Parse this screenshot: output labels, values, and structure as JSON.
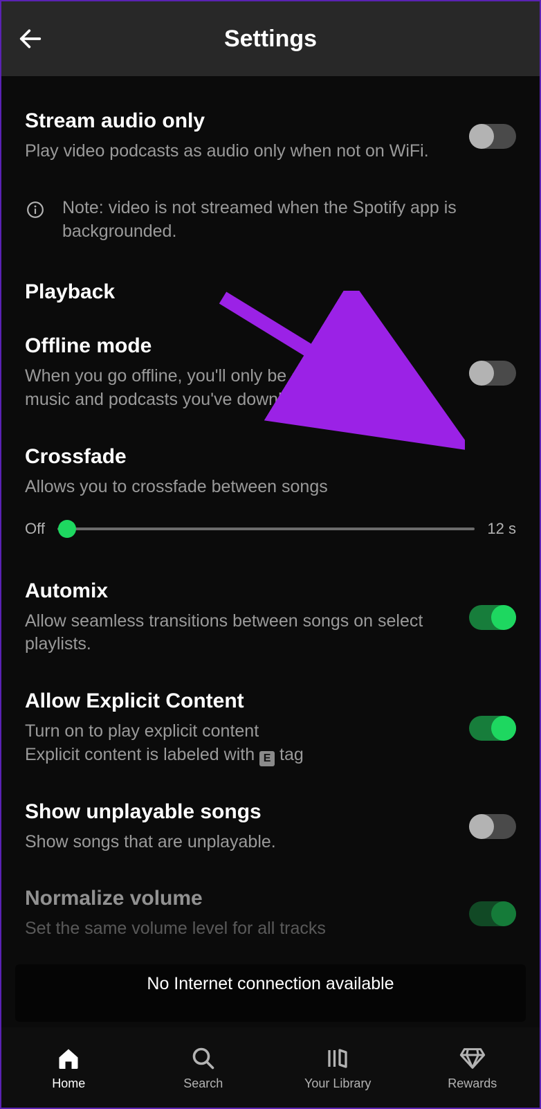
{
  "header": {
    "title": "Settings"
  },
  "settings": {
    "stream_audio": {
      "title": "Stream audio only",
      "desc": "Play video podcasts as audio only when not on WiFi.",
      "value": false
    },
    "note": "Note: video is not streamed when the Spotify app is backgrounded.",
    "section_playback": "Playback",
    "offline": {
      "title": "Offline mode",
      "desc": "When you go offline, you'll only be able to play the music and podcasts you've downloaded.",
      "value": false
    },
    "crossfade": {
      "title": "Crossfade",
      "desc": "Allows you to crossfade between songs",
      "min_label": "Off",
      "max_label": "12 s"
    },
    "automix": {
      "title": "Automix",
      "desc": "Allow seamless transitions between songs on select playlists.",
      "value": true
    },
    "explicit": {
      "title": "Allow Explicit Content",
      "desc1": "Turn on to play explicit content",
      "desc2_pre": "Explicit content is labeled with ",
      "desc2_post": " tag",
      "e_tag": "E",
      "value": true
    },
    "unplayable": {
      "title": "Show unplayable songs",
      "desc": "Show songs that are unplayable.",
      "value": false
    },
    "normalize": {
      "title": "Normalize volume",
      "desc": "Set the same volume level for all tracks",
      "value": true
    }
  },
  "banner": "No Internet connection available",
  "nav": {
    "home": "Home",
    "search": "Search",
    "library": "Your Library",
    "rewards": "Rewards"
  },
  "colors": {
    "accent": "#1ed760",
    "arrow": "#9b22e6"
  }
}
